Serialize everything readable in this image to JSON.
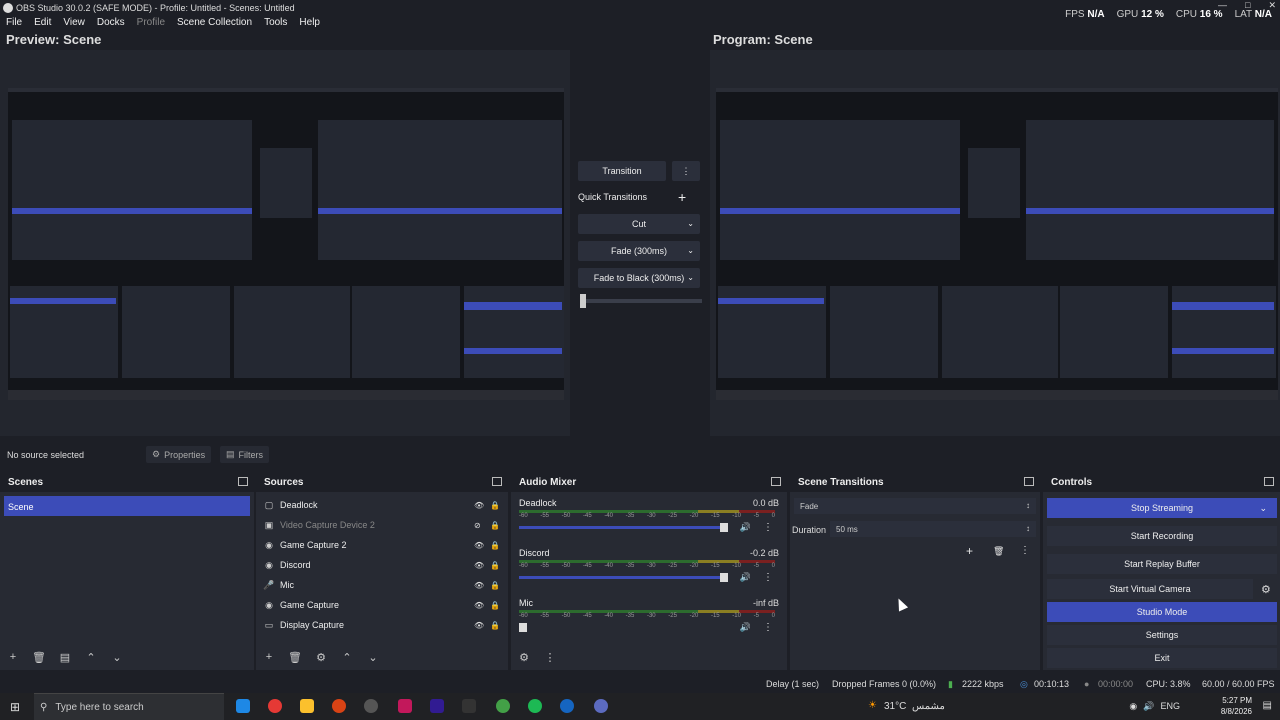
{
  "titlebar": {
    "title": "OBS Studio 30.0.2 (SAFE MODE) - Profile: Untitled - Scenes: Untitled",
    "stats": [
      {
        "label": "FPS",
        "value": "N/A"
      },
      {
        "label": "GPU",
        "value": "12 %"
      },
      {
        "label": "CPU",
        "value": "16 %"
      },
      {
        "label": "LAT",
        "value": "N/A"
      }
    ]
  },
  "menubar": {
    "items": [
      "File",
      "Edit",
      "View",
      "Docks",
      "Profile",
      "Scene Collection",
      "Tools",
      "Help"
    ]
  },
  "preview": {
    "left_label": "Preview: Scene",
    "right_label": "Program: Scene"
  },
  "transitions_panel": {
    "transition_label": "Transition",
    "quick_label": "Quick Transitions",
    "options": [
      "Cut",
      "Fade (300ms)",
      "Fade to Black (300ms)"
    ]
  },
  "source_toolbar": {
    "no_source": "No source selected",
    "properties": "Properties",
    "filters": "Filters"
  },
  "scenes": {
    "title": "Scenes",
    "items": [
      "Scene"
    ]
  },
  "sources": {
    "title": "Sources",
    "items": [
      {
        "name": "Deadlock",
        "icon": "window-capture-icon",
        "visible": true
      },
      {
        "name": "Video Capture Device 2",
        "icon": "camera-icon",
        "visible": false
      },
      {
        "name": "Game Capture 2",
        "icon": "gamepad-icon",
        "visible": true
      },
      {
        "name": "Discord",
        "icon": "gamepad-icon",
        "visible": true
      },
      {
        "name": "Mic",
        "icon": "mic-icon",
        "visible": true
      },
      {
        "name": "Game Capture",
        "icon": "gamepad-icon",
        "visible": true
      },
      {
        "name": "Display Capture",
        "icon": "monitor-icon",
        "visible": true
      }
    ]
  },
  "audio_mixer": {
    "title": "Audio Mixer",
    "ticks": [
      "-60",
      "-55",
      "-50",
      "-45",
      "-40",
      "-35",
      "-30",
      "-25",
      "-20",
      "-15",
      "-10",
      "-5",
      "0"
    ],
    "channels": [
      {
        "name": "Deadlock",
        "db": "0.0 dB",
        "level": 0.95
      },
      {
        "name": "Discord",
        "db": "-0.2 dB",
        "level": 0.95
      },
      {
        "name": "Mic",
        "db": "-inf dB",
        "level": 0.02
      }
    ]
  },
  "scene_transitions": {
    "title": "Scene Transitions",
    "selected": "Fade",
    "duration_label": "Duration",
    "duration_value": "50 ms"
  },
  "controls": {
    "title": "Controls",
    "buttons": [
      {
        "label": "Stop Streaming",
        "active": true
      },
      {
        "label": "Start Recording",
        "active": false
      },
      {
        "label": "Start Replay Buffer",
        "active": false
      },
      {
        "label": "Start Virtual Camera",
        "active": false
      },
      {
        "label": "Studio Mode",
        "active": true
      },
      {
        "label": "Settings",
        "active": false
      },
      {
        "label": "Exit",
        "active": false
      }
    ]
  },
  "statusbar": {
    "delay": "Delay (1 sec)",
    "dropped": "Dropped Frames 0 (0.0%)",
    "bitrate": "2222 kbps",
    "stream_time": "00:10:13",
    "rec_time": "00:00:00",
    "cpu": "CPU: 3.8%",
    "fps": "60.00 / 60.00 FPS"
  },
  "taskbar": {
    "search_placeholder": "Type here to search",
    "weather": "31°C",
    "weather_text": "مشمس",
    "lang": "ENG",
    "time": "5:27 PM",
    "date": "8/8/2026"
  },
  "colors": {
    "accent": "#3c4cb8",
    "background": "#1d1f26",
    "panel": "#272a33"
  }
}
